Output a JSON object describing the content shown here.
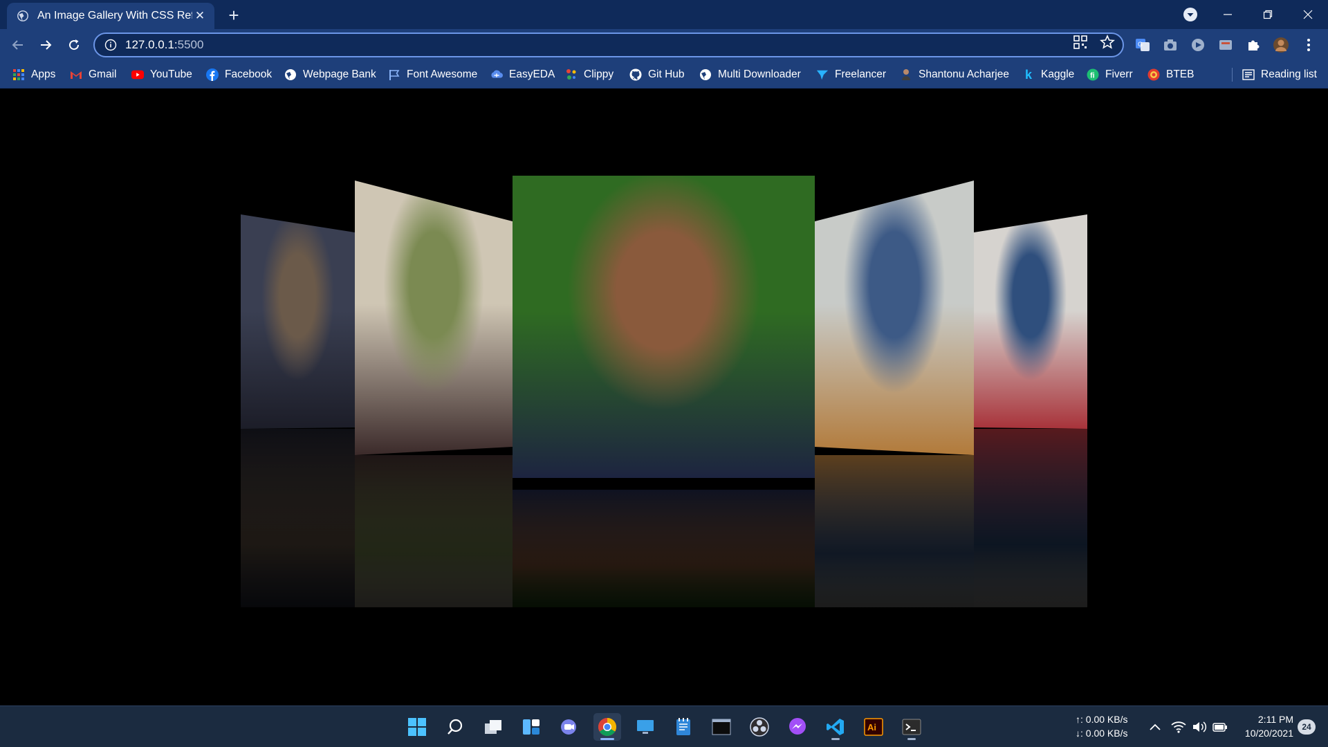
{
  "browser": {
    "tab_title": "An Image Gallery With CSS Refle",
    "new_tab_label": "+",
    "url_host": "127.0.0.1:",
    "url_port": "5500"
  },
  "bookmarks": [
    {
      "label": "Apps",
      "icon": "apps-grid-icon"
    },
    {
      "label": "Gmail",
      "icon": "gmail-icon"
    },
    {
      "label": "YouTube",
      "icon": "youtube-icon"
    },
    {
      "label": "Facebook",
      "icon": "facebook-icon"
    },
    {
      "label": "Webpage Bank",
      "icon": "globe-icon"
    },
    {
      "label": "Font Awesome",
      "icon": "flag-icon"
    },
    {
      "label": "EasyEDA",
      "icon": "easyeda-icon"
    },
    {
      "label": "Clippy",
      "icon": "clippy-icon"
    },
    {
      "label": "Git Hub",
      "icon": "github-icon"
    },
    {
      "label": "Multi Downloader",
      "icon": "globe-icon"
    },
    {
      "label": "Freelancer",
      "icon": "freelancer-icon"
    },
    {
      "label": "Shantonu Acharjee",
      "icon": "profile-icon"
    },
    {
      "label": "Kaggle",
      "icon": "kaggle-icon"
    },
    {
      "label": "Fiverr",
      "icon": "fiverr-icon"
    },
    {
      "label": "BTEB",
      "icon": "bteb-icon"
    }
  ],
  "reading_list": "Reading list",
  "gallery": {
    "images": [
      {
        "name": "gallery-image-1",
        "palette": [
          "#3a3f52",
          "#6b5a4a",
          "#1c1d28"
        ]
      },
      {
        "name": "gallery-image-2",
        "palette": [
          "#cfc6b4",
          "#7b8a52",
          "#3b2a2a"
        ]
      },
      {
        "name": "gallery-image-3",
        "palette": [
          "#2f6b22",
          "#8a5a3c",
          "#1d2440"
        ]
      },
      {
        "name": "gallery-image-4",
        "palette": [
          "#c8cbc8",
          "#3d5a86",
          "#b27a3a"
        ]
      },
      {
        "name": "gallery-image-5",
        "palette": [
          "#d6d3cf",
          "#2f4f7d",
          "#a8333a"
        ]
      }
    ]
  },
  "taskbar": {
    "upload_speed": "↑: 0.00 KB/s",
    "download_speed": "↓: 0.00 KB/s",
    "time": "2:11 PM",
    "date": "10/20/2021",
    "notification_count": "24"
  },
  "colors": {
    "titlebar": "#0f2a5a",
    "toolbar": "#1e3f7a",
    "taskbar": "#1b2b40",
    "page_background": "#000000",
    "omnibox_focus": "#6c96e8"
  }
}
